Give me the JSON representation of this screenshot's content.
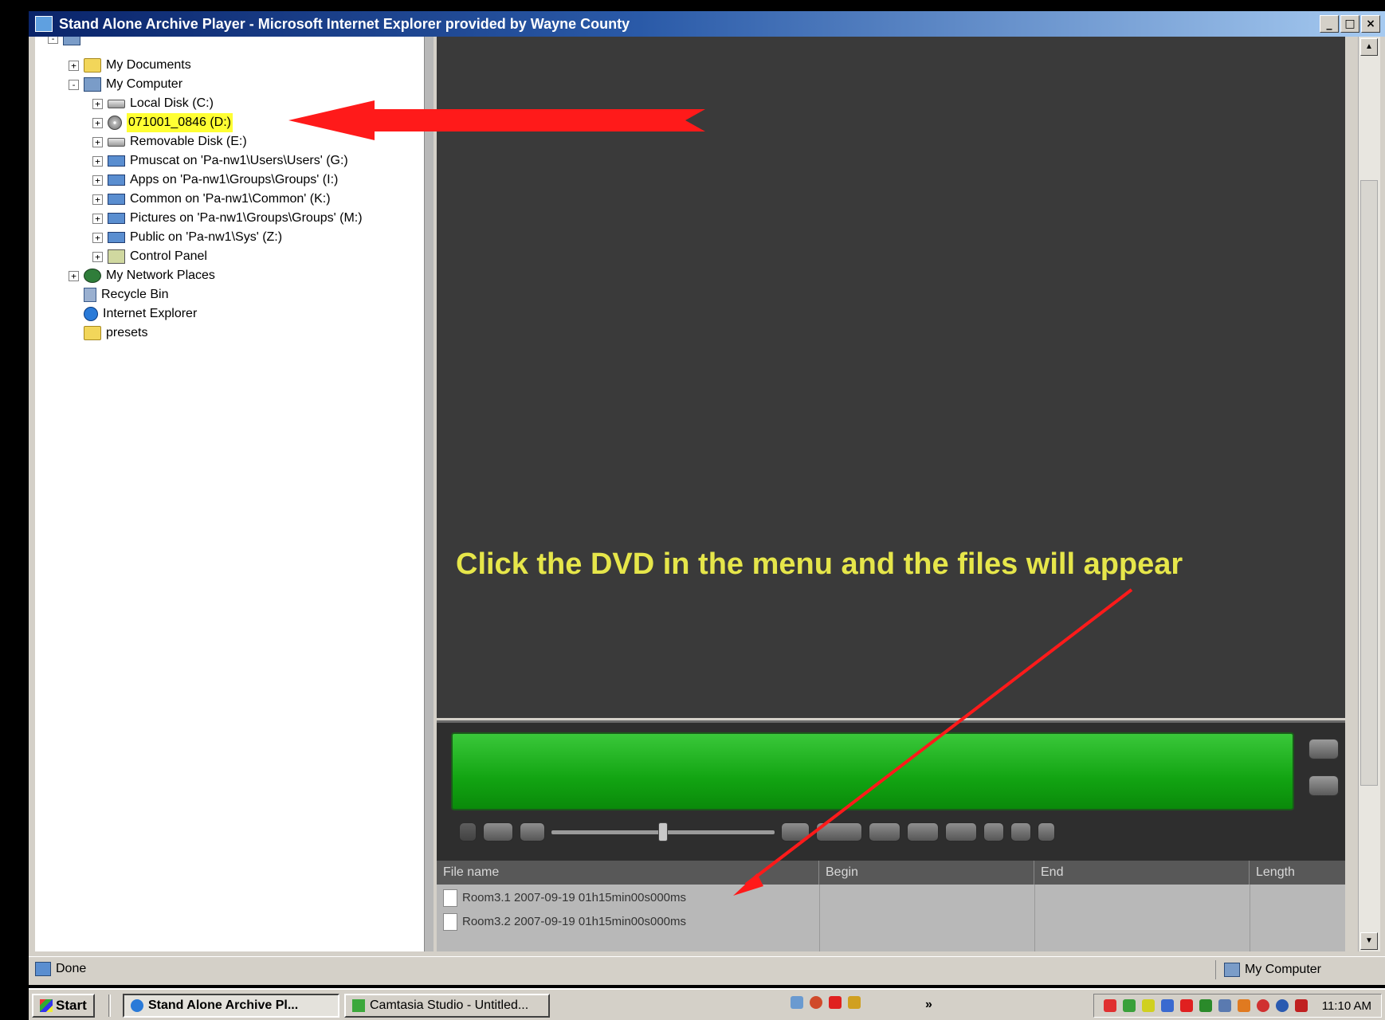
{
  "window": {
    "title": "Stand Alone Archive Player - Microsoft Internet Explorer provided by Wayne County",
    "minimize": "_",
    "maximize": "□",
    "close": "×"
  },
  "tree": {
    "items": [
      {
        "label": "My Documents",
        "icon": "folder-icon",
        "expander": "+"
      },
      {
        "label": "My Computer",
        "icon": "computer-icon",
        "expander": "-"
      },
      {
        "label": "Local Disk (C:)",
        "icon": "disk-icon",
        "expander": "+"
      },
      {
        "label": "071001_0846 (D:)",
        "icon": "cd-icon",
        "expander": "+"
      },
      {
        "label": "Removable Disk (E:)",
        "icon": "disk-icon",
        "expander": "+"
      },
      {
        "label": "Pmuscat on 'Pa-nw1\\Users\\Users' (G:)",
        "icon": "network-drive-icon",
        "expander": "+"
      },
      {
        "label": "Apps on 'Pa-nw1\\Groups\\Groups' (I:)",
        "icon": "network-drive-icon",
        "expander": "+"
      },
      {
        "label": "Common on 'Pa-nw1\\Common' (K:)",
        "icon": "network-drive-icon",
        "expander": "+"
      },
      {
        "label": "Pictures on 'Pa-nw1\\Groups\\Groups' (M:)",
        "icon": "network-drive-icon",
        "expander": "+"
      },
      {
        "label": "Public on 'Pa-nw1\\Sys' (Z:)",
        "icon": "network-drive-icon",
        "expander": "+"
      },
      {
        "label": "Control Panel",
        "icon": "control-panel-icon",
        "expander": "+"
      },
      {
        "label": "My Network Places",
        "icon": "network-places-icon",
        "expander": "+"
      },
      {
        "label": "Recycle Bin",
        "icon": "recycle-bin-icon",
        "expander": ""
      },
      {
        "label": "Internet Explorer",
        "icon": "ie-icon",
        "expander": ""
      },
      {
        "label": "presets",
        "icon": "folder-icon",
        "expander": ""
      }
    ]
  },
  "annotation": {
    "text": "Click the DVD  in the menu and the files will appear",
    "color": "#e6e64a",
    "arrow_color": "#ff1a1a"
  },
  "player": {
    "progress_color": "#12a412"
  },
  "filelist": {
    "columns": [
      "File name",
      "Begin",
      "End",
      "Length"
    ],
    "rows": [
      {
        "name": "Room3.1 2007-09-19 01h15min00s000ms"
      },
      {
        "name": "Room3.2 2007-09-19 01h15min00s000ms"
      }
    ]
  },
  "statusbar": {
    "left": "Done",
    "right": "My Computer"
  },
  "taskbar": {
    "start": "Start",
    "tasks": [
      "Stand Alone Archive Pl...",
      "Camtasia Studio - Untitled..."
    ],
    "clock": "11:10 AM",
    "chevron": "»"
  }
}
